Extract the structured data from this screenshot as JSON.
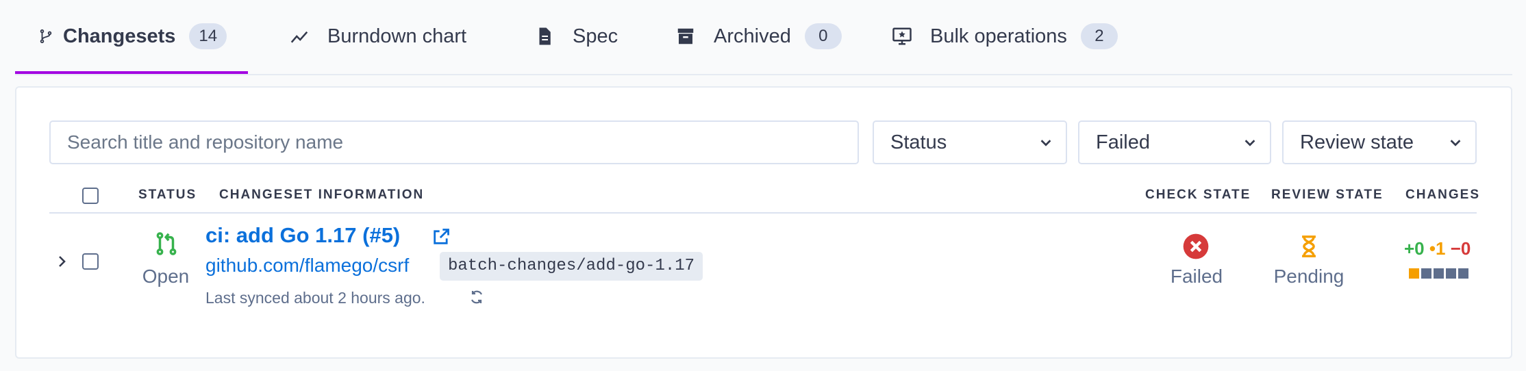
{
  "tabs": [
    {
      "label": "Changesets",
      "count": "14",
      "icon": "branch-icon",
      "active": true
    },
    {
      "label": "Burndown chart",
      "icon": "chart-line-icon"
    },
    {
      "label": "Spec",
      "icon": "document-icon"
    },
    {
      "label": "Archived",
      "count": "0",
      "icon": "archive-icon"
    },
    {
      "label": "Bulk operations",
      "count": "2",
      "icon": "monitor-star-icon"
    }
  ],
  "filters": {
    "search_placeholder": "Search title and repository name",
    "status": "Status",
    "check_state": "Failed",
    "review_state": "Review state"
  },
  "table": {
    "headers": {
      "status": "Status",
      "info": "Changeset information",
      "check_state": "Check state",
      "review_state": "Review state",
      "changes": "Changes"
    },
    "rows": [
      {
        "status": "Open",
        "title": "ci: add Go 1.17 (#5)",
        "repo": "github.com/flamego/csrf",
        "branch": "batch-changes/add-go-1.17",
        "synced": "Last synced about 2 hours ago.",
        "check_state": "Failed",
        "review_state": "Pending",
        "added": "+0",
        "changed": "•1",
        "deleted": "−0"
      }
    ]
  },
  "colors": {
    "accent": "#a305e1",
    "link": "#0b70db",
    "open": "#37b24d",
    "failed": "#d63a3a",
    "pending": "#f59f00",
    "diff_changed": "#f59f00",
    "diff_neutral": "#5e6e8c"
  }
}
